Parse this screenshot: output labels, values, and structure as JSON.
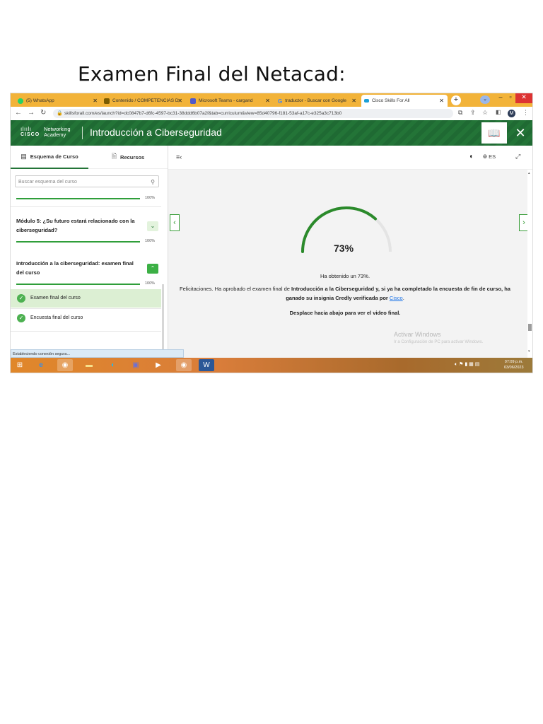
{
  "doc_title": "Examen Final del Netacad:",
  "browser": {
    "tabs": [
      {
        "label": "(5) WhatsApp",
        "color": "#25d366"
      },
      {
        "label": "Contenido / COMPETENCIAS D",
        "color": "#7a5b00"
      },
      {
        "label": "Microsoft Teams - cargand",
        "color": "#5059c9"
      },
      {
        "label": "traductor - Buscar con Google",
        "color": "#4285f4"
      },
      {
        "label": "Cisco Skills For All",
        "color": "#1ba0d7"
      }
    ],
    "close_glyph": "✕",
    "new_tab": "+",
    "url": "skillsforall.com/es/launch?id=dc0847b7-d6fc-4597-bc31-38ddd6b07a2f&tab=curriculum&view=85d40796-f181-53af-a17c-e325a3c713b0",
    "avatar_letter": "M"
  },
  "header": {
    "brand_line1": "Networking",
    "brand_line2": "Academy",
    "brand_cisco": "CISCO",
    "course_title": "Introducción a Ciberseguridad"
  },
  "sidebar": {
    "tab_outline": "Esquema de Curso",
    "tab_resources": "Recursos",
    "search_placeholder": "Buscar esquema del curso",
    "progress_top": "100%",
    "module5_title": "Módulo 5: ¿Su futuro estará relacionado con la ciberseguridad?",
    "module5_progress": "100%",
    "section_title": "Introducción a la ciberseguridad: examen final del curso",
    "section_progress": "100%",
    "items": [
      {
        "label": "Examen final del curso"
      },
      {
        "label": "Encuesta final del curso"
      }
    ]
  },
  "main": {
    "lang": "ES",
    "score_text": "73%",
    "score_value": 0.73,
    "obtained": "Ha obtenido un 73%.",
    "congrats_a": "Felicitaciones. Ha aprobado el examen final de ",
    "congrats_b": "Introducción a la Ciberseguridad y, si ya ha completado la encuesta de fin de curso, ha ganado su insignia Credly verificada por ",
    "congrats_link": "Cisco",
    "congrats_end": ".",
    "scroll_hint": "Desplace hacia abajo para ver el video final.",
    "watermark_1": "Activar Windows",
    "watermark_2": "Ir a Configuración de PC para activar Windows."
  },
  "status_text": "Estableciendo conexión segura...",
  "taskbar": {
    "time": "07:09 p.m.",
    "date": "03/06/2023"
  },
  "colors": {
    "green": "#237437",
    "gauge": "#2f9e3a",
    "tabbar": "#f2b339"
  }
}
